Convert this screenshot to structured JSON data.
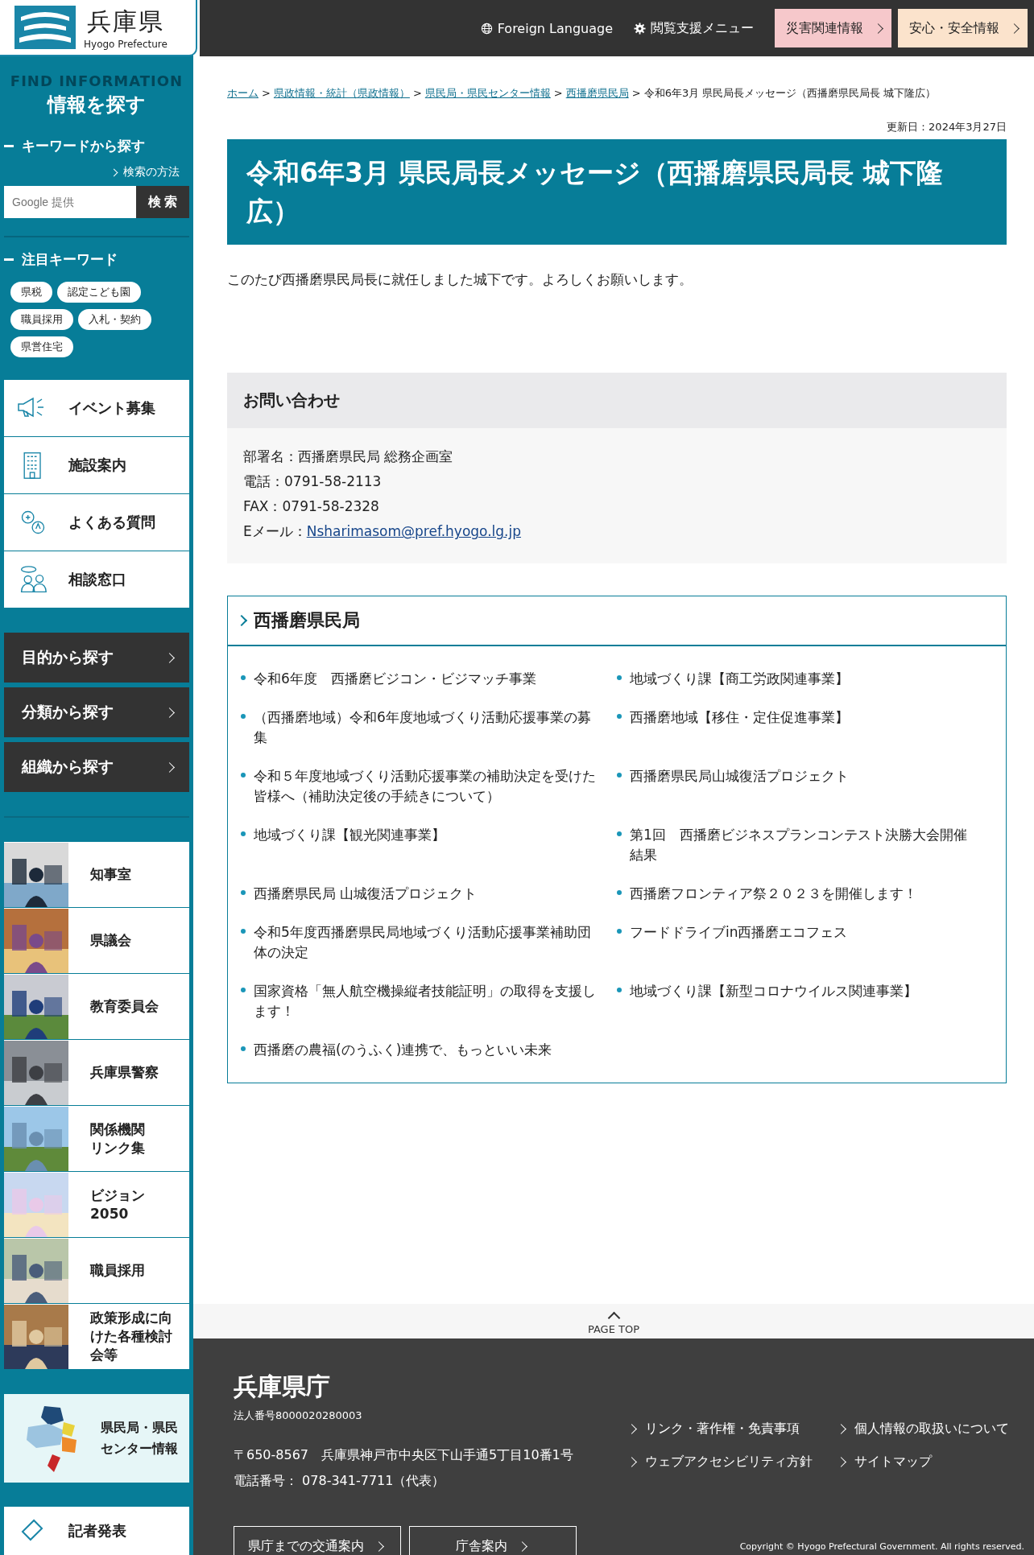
{
  "logo": {
    "name": "兵庫県",
    "sub": "Hyogo Prefecture"
  },
  "header": {
    "links": [
      {
        "label": "Foreign Language",
        "kind": "globe"
      },
      {
        "label": "閲覧支援メニュー",
        "kind": "gear"
      }
    ],
    "alerts": [
      {
        "label": "災害関連情報",
        "color": "#f6c8cb"
      },
      {
        "label": "安心・安全情報",
        "color": "#fbe3cc"
      }
    ]
  },
  "sidebar": {
    "deco": "FIND INFORMATION",
    "title": "情報を探す",
    "keyword_heading": "キーワードから探す",
    "search_help": "検索の方法",
    "search": {
      "placeholder": "Google 提供",
      "button": "検 索"
    },
    "tags_heading": "注目キーワード",
    "tags": [
      "県税",
      "認定こども園",
      "職員採用",
      "入札・契約",
      "県営住宅"
    ],
    "nav": [
      "イベント募集",
      "施設案内",
      "よくある質問",
      "相談窓口"
    ],
    "browse": [
      "目的から探す",
      "分類から探す",
      "組織から探す"
    ],
    "photo_links": [
      {
        "label": "知事室",
        "kind": "picture"
      },
      {
        "label": "県議会",
        "kind": "picture"
      },
      {
        "label": "教育委員会",
        "kind": "picture"
      },
      {
        "label": "兵庫県警察",
        "kind": "picture"
      },
      {
        "label": [
          "関係機関",
          "リンク集"
        ],
        "kind": "picture"
      },
      {
        "label": [
          "ビジョン",
          "2050"
        ],
        "kind": "picture"
      },
      {
        "label": "職員採用",
        "kind": "picture"
      },
      {
        "label": [
          "政策形成に向",
          "けた各種検討",
          "会等"
        ],
        "kind": "picture"
      }
    ],
    "map_link": [
      "県民局・県民",
      "センター情報"
    ],
    "last_link": "記者発表"
  },
  "breadcrumb": [
    {
      "label": "ホーム",
      "link": true
    },
    {
      "sep": ">",
      "label": "県政情報・統計（県政情報）",
      "link": true
    },
    {
      "sep": ">",
      "label": "県民局・県民センター情報",
      "link": true
    },
    {
      "sep": ">",
      "label": "西播磨県民局",
      "link": true
    },
    {
      "sep": ">",
      "label": "令和6年3月 県民局長メッセージ（西播磨県民局長 城下隆広）",
      "link": false
    }
  ],
  "updated": "更新日：2024年3月27日",
  "title": "令和6年3月 県民局長メッセージ（西播磨県民局長 城下隆広）",
  "intro": "このたび西播磨県民局長に就任しました城下です。よろしくお願いします。",
  "contact": {
    "heading": "お問い合わせ",
    "lines": [
      "部署名：西播磨県民局 総務企画室",
      "電話：0791-58-2113",
      "FAX：0791-58-2328"
    ],
    "email_label": "Eメール：",
    "email": "Nsharimasom@pref.hyogo.lg.jp"
  },
  "section": {
    "heading": "西播磨県民局",
    "items": [
      "令和6年度　西播磨ビジコン・ビジマッチ事業",
      "地域づくり課【商工労政関連事業】",
      "（西播磨地域）令和6年度地域づくり活動応援事業の募集",
      "西播磨地域【移住・定住促進事業】",
      "令和５年度地域づくり活動応援事業の補助決定を受けた皆様へ（補助決定後の手続きについて）",
      "西播磨県民局山城復活プロジェクト",
      "地域づくり課【観光関連事業】",
      "第1回　西播磨ビジネスプランコンテスト決勝大会開催結果",
      "西播磨県民局 山城復活プロジェクト",
      "西播磨フロンティア祭２０２３を開催します！",
      "令和5年度西播磨県民局地域づくり活動応援事業補助団体の決定",
      "フードドライブin西播磨エコフェス",
      "国家資格「無人航空機操縦者技能証明」の取得を支援します！",
      "地域づくり課【新型コロナウイルス関連事業】",
      "西播磨の農福(のうふく)連携で、もっといい未来"
    ]
  },
  "page_top": "PAGE TOP",
  "footer": {
    "name": "兵庫県庁",
    "corp": "法人番号8000020280003",
    "address": "〒650-8567　兵庫県神戸市中央区下山手通5丁目10番1号",
    "phone": "電話番号： 078-341-7711（代表）",
    "links": [
      "リンク・著作権・免責事項",
      "個人情報の取扱いについて",
      "ウェブアクセシビリティ方針",
      "サイトマップ"
    ],
    "buttons": [
      "県庁までの交通案内",
      "庁舎案内"
    ],
    "copyright": "Copyright © Hyogo Prefectural Government. All rights reserved."
  }
}
